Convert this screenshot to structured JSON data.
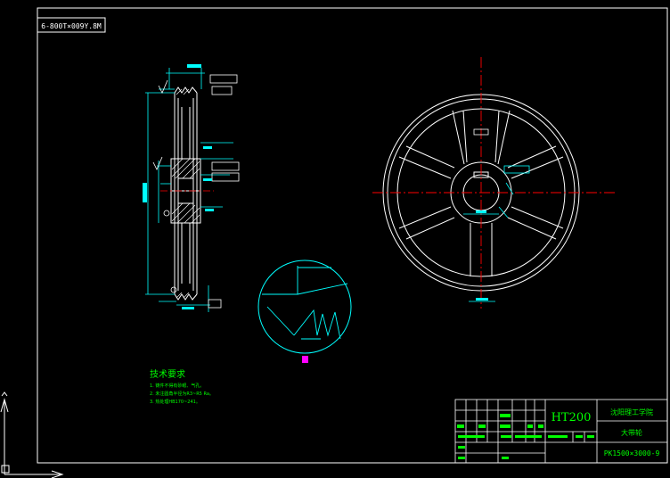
{
  "drawing_title_box": "6-800T×009Y.8M",
  "technical_requirements": {
    "heading": "技术要求",
    "items": [
      "1. 铸件不得有砂眼、气孔。",
      "2. 未注圆角半径为R3~R5 Ra。",
      "3. 热处理HB170~241。"
    ]
  },
  "title_block": {
    "material": "HT200",
    "school": "沈阳理工学院",
    "part_name": "大带轮",
    "drawing_number": "PK1500×3000-9"
  },
  "colors": {
    "background": "#000000",
    "outline": "#ffffff",
    "centerline": "#ff0000",
    "dimension": "#00ffff",
    "text": "#00ff00",
    "highlight": "#ff00ff"
  }
}
